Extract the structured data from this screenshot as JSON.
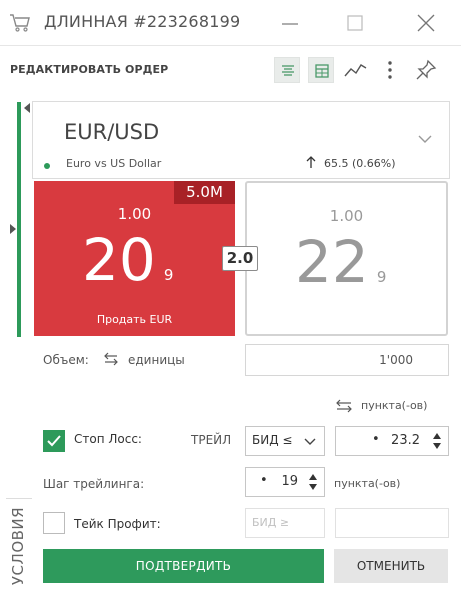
{
  "window": {
    "title": "ДЛИННАЯ #223268199"
  },
  "header": {
    "edit_title": "РЕДАКТИРОВАТЬ ОРДЕР"
  },
  "instrument": {
    "symbol": "EUR/USD",
    "description": "Euro vs US Dollar",
    "change": "65.5 (0.66%)"
  },
  "sell": {
    "size": "5.0M",
    "big_figure": "1.00",
    "pips": "20",
    "fraction": "9",
    "label": "Продать EUR",
    "color": "#d83a3f"
  },
  "buy": {
    "big_figure": "1.00",
    "pips": "22",
    "fraction": "9"
  },
  "spread": "2.0",
  "volume": {
    "label": "Объем:",
    "unit": "единицы",
    "value": "1'000"
  },
  "points_header": "пункта(-ов)",
  "stop_loss": {
    "label": "Стоп Лосс:",
    "checked": true,
    "trail_label": "ТРЕЙЛ",
    "condition": "БИД ≤",
    "value": "23.2",
    "bullet": "•"
  },
  "trailing_step": {
    "label": "Шаг трейлинга:",
    "value": "19",
    "bullet": "•",
    "unit": "пункта(-ов)"
  },
  "take_profit": {
    "label": "Тейк Профит:",
    "checked": false,
    "condition": "БИД ≥"
  },
  "side_tab": "УСЛОВИЯ",
  "buttons": {
    "confirm": "ПОДТВЕРДИТЬ",
    "cancel": "ОТМЕНИТЬ"
  },
  "colors": {
    "accent_green": "#2e9a5c",
    "sell_red": "#d83a3f",
    "badge_red": "#a82126"
  },
  "icons": [
    "cart-icon",
    "minimize-icon",
    "maximize-icon",
    "close-icon",
    "layout-list-icon",
    "calculator-icon",
    "chart-line-icon",
    "more-vertical-icon",
    "pin-icon",
    "chevron-down-icon",
    "arrow-up-icon",
    "swap-arrows-icon",
    "check-icon",
    "spinner-arrows-icon"
  ]
}
